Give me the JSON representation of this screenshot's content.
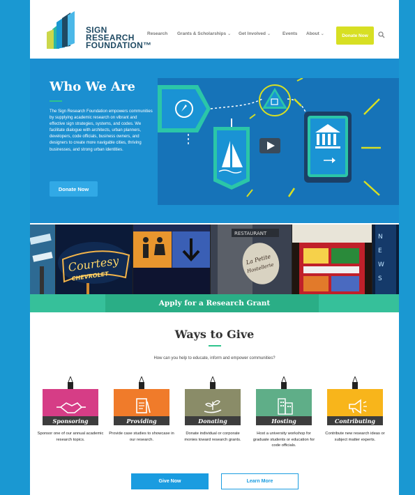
{
  "header": {
    "logo_lines": [
      "SIGN",
      "RESEARCH",
      "FOUNDATION™"
    ],
    "nav": [
      {
        "label": "Research",
        "dropdown": false
      },
      {
        "label": "Grants & Scholarships",
        "dropdown": true
      },
      {
        "label": "Get Involved",
        "dropdown": true
      },
      {
        "label": "Events",
        "dropdown": false
      },
      {
        "label": "About",
        "dropdown": true
      }
    ],
    "chevron": "⌄",
    "donate_label": "Donate Now",
    "search_icon": "search-icon"
  },
  "hero": {
    "title": "Who We Are",
    "body": "The Sign Research Foundation empowers communities by supplying academic research on vibrant and effective sign strategies, systems, and codes. We facilitate dialogue with architects, urban planners, developers, code officials, business owners, and designers to create more navigable cities, thriving businesses, and strong urban identities.",
    "button_label": "Donate Now"
  },
  "photo_strip": {
    "sign_texts": [
      "Courtesy",
      "CHEVROLET",
      "RESTAURANT",
      "La Petite",
      "Hostellerie"
    ],
    "grant_banner": "Apply for a Research Grant"
  },
  "ways_to_give": {
    "title": "Ways to Give",
    "subtitle": "How can you help to educate, inform and empower communities?",
    "cards": [
      {
        "label": "Sponsoring",
        "desc": "Sponsor one of our annual academic research topics.",
        "color": "#d63d86",
        "icon": "handshake-icon"
      },
      {
        "label": "Providing",
        "desc": "Provide case studies to showcase in our research.",
        "color": "#f07b2a",
        "icon": "document-icon"
      },
      {
        "label": "Donating",
        "desc": "Donate individual or corporate monies toward research grants.",
        "color": "#8a8c68",
        "icon": "plant-hand-icon"
      },
      {
        "label": "Hosting",
        "desc": "Host a university workshop for graduate students or education for code officials.",
        "color": "#5fae88",
        "icon": "building-icon"
      },
      {
        "label": "Contributing",
        "desc": "Contribute new research ideas or subject matter experts.",
        "color": "#f8b51b",
        "icon": "megaphone-icon"
      }
    ],
    "give_label": "Give Now",
    "learn_label": "Learn More"
  },
  "colors": {
    "brand_blue": "#1b8fd0",
    "accent_green": "#2ec48c",
    "donate_yellow": "#d7df23"
  }
}
